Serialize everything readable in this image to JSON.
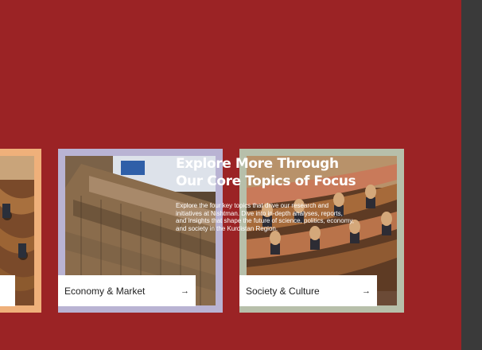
{
  "section": {
    "heading": "Explore More Through Our Core Topics of Focus",
    "description": "Explore the four key topics that drive our research and initiatives at Nishtman. Dive into in-depth analyses, reports, and insights that shape the future of science, politics, economy, and society in the Kurdistan Region."
  },
  "cards": [
    {
      "label": "",
      "arrow": "→",
      "frame_color": "#efb07a"
    },
    {
      "label": "Economy & Market",
      "arrow": "→",
      "frame_color": "#b9b3d3"
    },
    {
      "label": "Society & Culture",
      "arrow": "→",
      "frame_color": "#b7bfaa"
    }
  ],
  "colors": {
    "background": "#9b2325",
    "scrollbar": "#3a3a3a"
  }
}
